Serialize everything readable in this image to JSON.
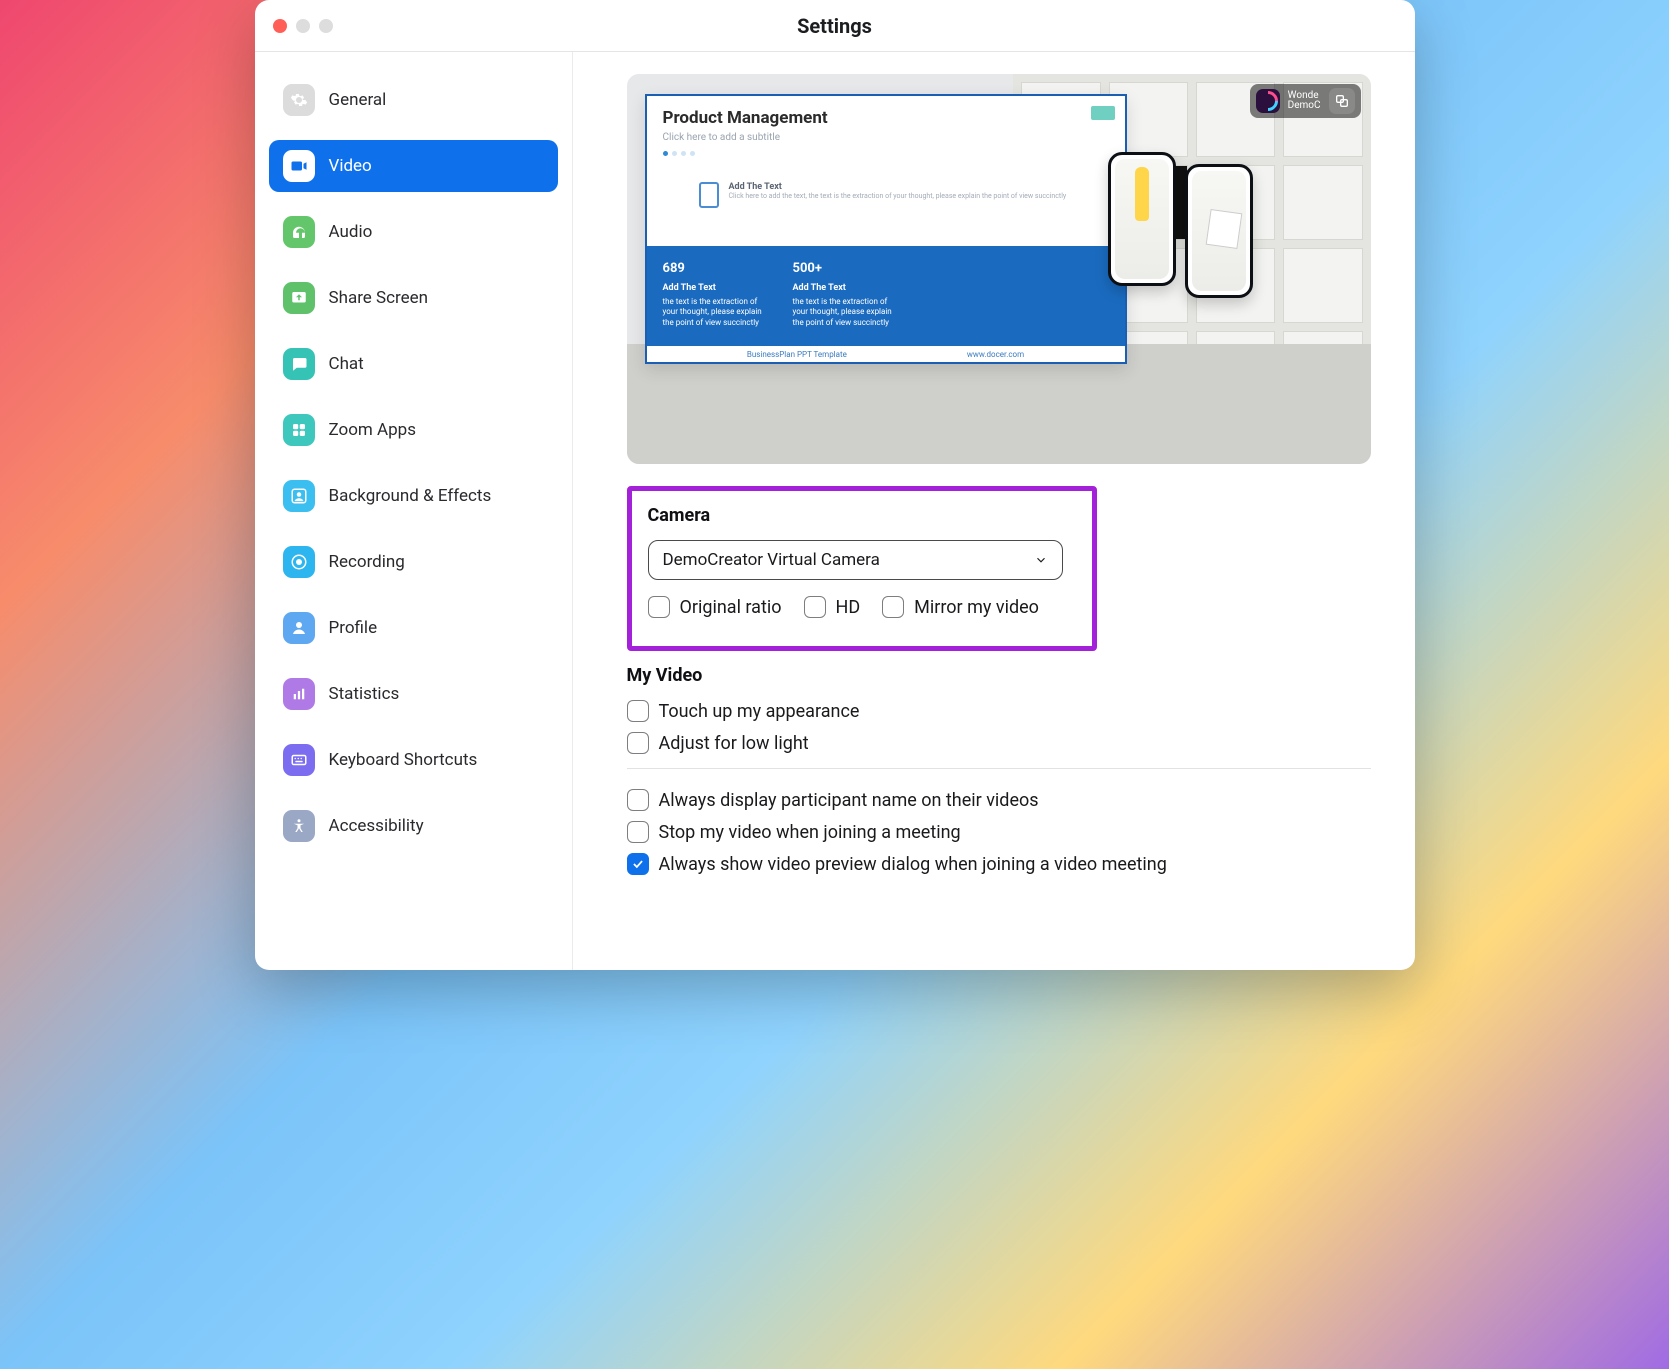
{
  "window": {
    "title": "Settings"
  },
  "sidebar": {
    "items": [
      {
        "label": "General",
        "iconBg": "#dcdcdc",
        "iconFg": "#ffffff",
        "active": false,
        "name": "sidebar-item-general",
        "iconName": "gear-icon"
      },
      {
        "label": "Video",
        "iconBg": "#ffffff",
        "iconFg": "#0e71eb",
        "active": true,
        "name": "sidebar-item-video",
        "iconName": "video-icon"
      },
      {
        "label": "Audio",
        "iconBg": "#63c66b",
        "iconFg": "#ffffff",
        "active": false,
        "name": "sidebar-item-audio",
        "iconName": "headphones-icon"
      },
      {
        "label": "Share Screen",
        "iconBg": "#5fc26b",
        "iconFg": "#ffffff",
        "active": false,
        "name": "sidebar-item-share-screen",
        "iconName": "share-screen-icon"
      },
      {
        "label": "Chat",
        "iconBg": "#35c3b6",
        "iconFg": "#ffffff",
        "active": false,
        "name": "sidebar-item-chat",
        "iconName": "chat-icon"
      },
      {
        "label": "Zoom Apps",
        "iconBg": "#3ec7bd",
        "iconFg": "#ffffff",
        "active": false,
        "name": "sidebar-item-zoom-apps",
        "iconName": "apps-icon"
      },
      {
        "label": "Background & Effects",
        "iconBg": "#3bbef0",
        "iconFg": "#ffffff",
        "active": false,
        "name": "sidebar-item-background-effects",
        "iconName": "person-frame-icon"
      },
      {
        "label": "Recording",
        "iconBg": "#2cb5ee",
        "iconFg": "#ffffff",
        "active": false,
        "name": "sidebar-item-recording",
        "iconName": "record-icon"
      },
      {
        "label": "Profile",
        "iconBg": "#5ea8f2",
        "iconFg": "#ffffff",
        "active": false,
        "name": "sidebar-item-profile",
        "iconName": "user-icon"
      },
      {
        "label": "Statistics",
        "iconBg": "#b07ae6",
        "iconFg": "#ffffff",
        "active": false,
        "name": "sidebar-item-statistics",
        "iconName": "bar-chart-icon"
      },
      {
        "label": "Keyboard Shortcuts",
        "iconBg": "#7c6df0",
        "iconFg": "#ffffff",
        "active": false,
        "name": "sidebar-item-keyboard-shortcuts",
        "iconName": "keyboard-icon"
      },
      {
        "label": "Accessibility",
        "iconBg": "#9aa7c5",
        "iconFg": "#ffffff",
        "active": false,
        "name": "sidebar-item-accessibility",
        "iconName": "accessibility-icon"
      }
    ]
  },
  "preview": {
    "slide": {
      "title": "Product Management",
      "subtitle": "Click here to add a subtitle",
      "midHeading": "Add The Text",
      "midSub": "Click here to add the text, the text is the extraction of your thought,\nplease explain the point of view succinctly",
      "bottom": {
        "col1": {
          "big": "689",
          "h": "Add The Text",
          "t": "the text is the extraction of your thought, please explain the point of view succinctly"
        },
        "col2": {
          "big": "500+",
          "h": "Add The Text",
          "t": "the text is the extraction of your thought, please explain the point of view succinctly"
        }
      },
      "footerLeft": "BusinessPlan PPT Template",
      "footerRight": "www.docer.com"
    },
    "watermark": {
      "name": "Wonde",
      "sub": "DemoC"
    }
  },
  "camera": {
    "section": "Camera",
    "selected": "DemoCreator Virtual Camera",
    "options": [
      {
        "label": "Original ratio",
        "checked": false
      },
      {
        "label": "HD",
        "checked": false
      },
      {
        "label": "Mirror my video",
        "checked": false
      }
    ]
  },
  "myvideo": {
    "section": "My Video",
    "options": [
      {
        "label": "Touch up my appearance",
        "checked": false
      },
      {
        "label": "Adjust for low light",
        "checked": false
      }
    ],
    "more": [
      {
        "label": "Always display participant name on their videos",
        "checked": false
      },
      {
        "label": "Stop my video when joining a meeting",
        "checked": false
      },
      {
        "label": "Always show video preview dialog when joining a video meeting",
        "checked": true
      }
    ]
  }
}
